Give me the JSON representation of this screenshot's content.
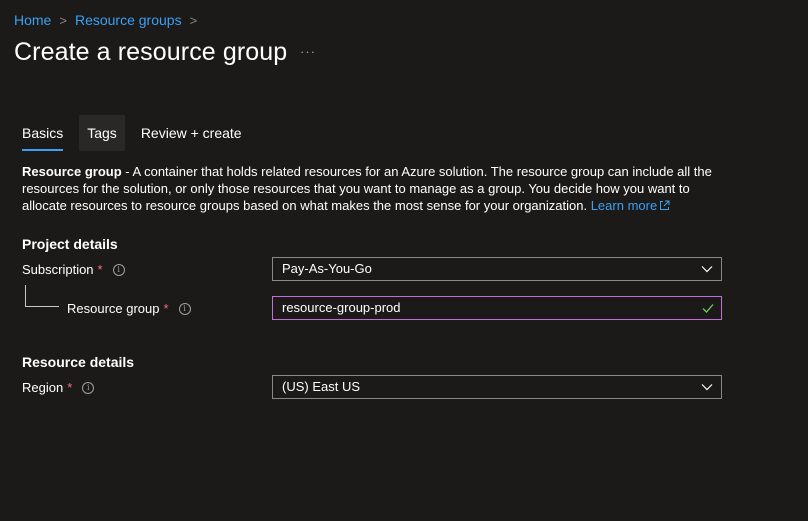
{
  "breadcrumb": {
    "home": "Home",
    "resource_groups": "Resource groups",
    "separator": ">"
  },
  "page": {
    "title": "Create a resource group",
    "more": "···"
  },
  "tabs": [
    {
      "label": "Basics",
      "active": true
    },
    {
      "label": "Tags",
      "active": false
    },
    {
      "label": "Review + create",
      "active": false
    }
  ],
  "description": {
    "term": "Resource group",
    "text": " - A container that holds related resources for an Azure solution. The resource group can include all the resources for the solution, or only those resources that you want to manage as a group. You decide how you want to allocate resources to resource groups based on what makes the most sense for your organization. ",
    "link": "Learn more"
  },
  "project_details": {
    "heading": "Project details",
    "subscription": {
      "label": "Subscription",
      "required": "*",
      "value": "Pay-As-You-Go"
    },
    "resource_group": {
      "label": "Resource group",
      "required": "*",
      "value": "resource-group-prod"
    }
  },
  "resource_details": {
    "heading": "Resource details",
    "region": {
      "label": "Region",
      "required": "*",
      "value": "(US) East US"
    }
  },
  "icons": {
    "info": "info-icon",
    "chevron": "chevron-down-icon",
    "check": "checkmark-icon",
    "external": "external-link-icon"
  },
  "colors": {
    "background": "#1b1a19",
    "link": "#3aa0f3",
    "required": "#f1707b",
    "focus_border": "#c36ed6",
    "valid_check": "#6ccb5f"
  }
}
